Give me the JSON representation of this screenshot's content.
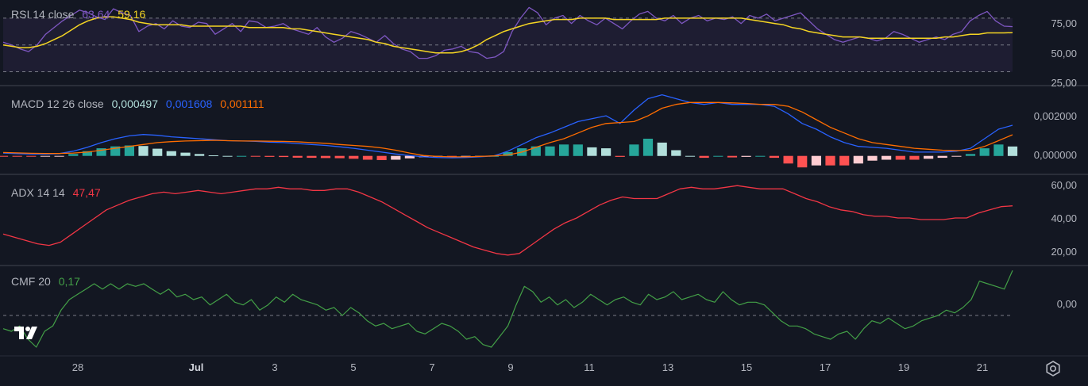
{
  "colors": {
    "background": "#131722",
    "rsi": "#7e57c2",
    "rsi_ma": "#f5d523",
    "macd": "#2962ff",
    "signal": "#ff6d00",
    "hist_pos": "#26a69a",
    "hist_neg": "#ef5350",
    "adx": "#f23645",
    "cmf": "#43a047"
  },
  "panes": {
    "rsi": {
      "name": "RSI 14 close",
      "value1": "63,64",
      "value2": "59,16",
      "ticks": [
        "75,00",
        "50,00",
        "25,00"
      ],
      "bands": [
        70,
        50,
        30
      ]
    },
    "macd": {
      "name": "MACD 12 26 close",
      "value1": "0,000497",
      "value2": "0,001608",
      "value3": "0,001111",
      "ticks": [
        "0,002000",
        "0,000000"
      ]
    },
    "adx": {
      "name": "ADX 14 14",
      "value1": "47,47",
      "ticks": [
        "60,00",
        "40,00",
        "20,00"
      ]
    },
    "cmf": {
      "name": "CMF 20",
      "value1": "0,17",
      "ticks": [
        "0,00"
      ]
    }
  },
  "x_axis": {
    "labels": [
      "28",
      "Jul",
      "3",
      "5",
      "7",
      "9",
      "11",
      "13",
      "15",
      "17",
      "19",
      "21"
    ]
  },
  "icons": {
    "logo": "tradingview-logo-icon",
    "settings": "settings-gear-icon"
  },
  "chart_data": [
    {
      "type": "line",
      "name": "RSI",
      "series": [
        {
          "name": "RSI 14 close",
          "values": [
            52,
            50,
            47,
            45,
            50,
            58,
            63,
            68,
            72,
            76,
            74,
            71,
            69,
            77,
            74,
            72,
            60,
            64,
            66,
            62,
            68,
            64,
            63,
            67,
            66,
            58,
            62,
            66,
            60,
            68,
            67,
            63,
            64,
            66,
            62,
            60,
            58,
            63,
            56,
            52,
            55,
            60,
            58,
            55,
            52,
            57,
            51,
            47,
            45,
            40,
            40,
            42,
            46,
            47,
            49,
            45,
            44,
            40,
            41,
            45,
            60,
            70,
            78,
            74,
            65,
            70,
            72,
            66,
            72,
            68,
            65,
            70,
            66,
            62,
            68,
            73,
            75,
            70,
            68,
            72,
            66,
            70,
            72,
            68,
            70,
            69,
            71,
            66,
            72,
            70,
            73,
            68,
            70,
            72,
            74,
            68,
            62,
            58,
            54,
            52,
            54,
            56,
            55,
            53,
            55,
            60,
            58,
            55,
            52,
            54,
            56,
            54,
            58,
            60,
            68,
            72,
            75,
            68,
            64,
            63.64
          ]
        },
        {
          "name": "MA",
          "values": [
            50,
            49,
            48,
            48,
            49,
            51,
            54,
            57,
            61,
            65,
            68,
            70,
            71,
            71,
            70,
            69,
            67,
            66,
            65,
            65,
            65,
            65,
            64,
            64,
            64,
            64,
            64,
            64,
            64,
            63,
            63,
            63,
            63,
            63,
            62,
            62,
            61,
            60,
            59,
            58,
            57,
            56,
            55,
            54,
            52,
            51,
            49,
            48,
            47,
            46,
            45,
            44,
            44,
            44,
            45,
            47,
            50,
            54,
            57,
            60,
            62,
            64,
            66,
            67,
            68,
            69,
            69,
            69,
            70,
            70,
            70,
            70,
            69,
            69,
            69,
            69,
            69,
            69,
            70,
            70,
            70,
            70,
            70,
            70,
            70,
            70,
            70,
            70,
            69,
            68,
            67,
            66,
            65,
            63,
            62,
            60,
            59,
            58,
            57,
            56,
            56,
            56,
            55,
            55,
            55,
            55,
            55,
            55,
            55,
            55,
            55,
            56,
            56,
            57,
            58,
            58,
            59,
            59,
            59,
            59.16
          ]
        }
      ],
      "ylim": [
        22,
        80
      ]
    },
    {
      "type": "line",
      "name": "MACD",
      "series": [
        {
          "name": "MACD",
          "values": [
            0.00015,
            0.00012,
            0.0001,
            0.0001,
            0.00012,
            0.00025,
            0.00045,
            0.0007,
            0.0009,
            0.00105,
            0.00112,
            0.00108,
            0.001,
            0.00095,
            0.0009,
            0.00085,
            0.0008,
            0.00078,
            0.00076,
            0.00072,
            0.0007,
            0.00065,
            0.0006,
            0.00055,
            0.00048,
            0.0004,
            0.0003,
            0.0002,
            0.0001,
            2e-05,
            -5e-05,
            -8e-05,
            -0.0001,
            -8e-05,
            -5e-05,
            0.0,
            0.00025,
            0.0006,
            0.00095,
            0.0012,
            0.0015,
            0.0018,
            0.00195,
            0.0021,
            0.0017,
            0.0024,
            0.003,
            0.0032,
            0.003,
            0.0028,
            0.0027,
            0.0028,
            0.0027,
            0.0027,
            0.0027,
            0.0026,
            0.0022,
            0.0017,
            0.0014,
            0.001,
            0.0007,
            0.0005,
            0.00045,
            0.0004,
            0.0003,
            0.0002,
            0.0002,
            0.0002,
            0.00025,
            0.0004,
            0.0009,
            0.0014,
            0.001608
          ]
        },
        {
          "name": "Signal",
          "values": [
            0.00018,
            0.00016,
            0.00014,
            0.00013,
            0.00013,
            0.00015,
            0.0002,
            0.0003,
            0.0004,
            0.0005,
            0.0006,
            0.0007,
            0.00075,
            0.00078,
            0.0008,
            0.00082,
            0.0008,
            0.00078,
            0.00078,
            0.00077,
            0.00076,
            0.00074,
            0.0007,
            0.00066,
            0.0006,
            0.00055,
            0.0005,
            0.00042,
            0.0003,
            0.00015,
            2e-05,
            -3e-05,
            -5e-05,
            -5e-05,
            -3e-05,
            0.0,
            5e-05,
            0.0002,
            0.00045,
            0.0007,
            0.0009,
            0.0012,
            0.0015,
            0.0017,
            0.00175,
            0.0018,
            0.0021,
            0.0025,
            0.0027,
            0.0028,
            0.0028,
            0.0028,
            0.00278,
            0.00275,
            0.0027,
            0.0027,
            0.0026,
            0.0023,
            0.0019,
            0.0015,
            0.0012,
            0.0009,
            0.0007,
            0.0006,
            0.0005,
            0.0004,
            0.00035,
            0.0003,
            0.00028,
            0.0003,
            0.0005,
            0.0008,
            0.001111
          ]
        },
        {
          "name": "Histogram",
          "values": [
            -3e-05,
            -4e-05,
            -4e-05,
            -3e-05,
            -1e-05,
            0.0001,
            0.00025,
            0.0004,
            0.0005,
            0.00055,
            0.00052,
            0.00038,
            0.00025,
            0.00017,
            0.0001,
            3e-05,
            0.0,
            0.0,
            -2e-05,
            -5e-05,
            -6e-05,
            -9e-05,
            -0.0001,
            -0.00011,
            -0.00012,
            -0.00015,
            -0.0002,
            -0.00022,
            -0.0002,
            -0.00013,
            -7e-05,
            -5e-05,
            -5e-05,
            -3e-05,
            -2e-05,
            0.0,
            0.0002,
            0.0004,
            0.0005,
            0.0005,
            0.0006,
            0.0006,
            0.00045,
            0.0004,
            -5e-05,
            0.0006,
            0.0009,
            0.0007,
            0.0003,
            0.0,
            -0.0001,
            0.0,
            -8e-05,
            -5e-05,
            0.0,
            -0.0001,
            -0.0004,
            -0.0006,
            -0.0005,
            -0.0005,
            -0.0005,
            -0.0004,
            -0.00025,
            -0.0002,
            -0.0002,
            -0.0002,
            -0.00015,
            -0.0001,
            -3e-05,
            0.0001,
            0.0004,
            0.0006,
            0.000497
          ]
        }
      ],
      "ylim": [
        -0.0008,
        0.0036
      ]
    },
    {
      "type": "line",
      "name": "ADX",
      "series": [
        {
          "name": "ADX 14 14",
          "values": [
            30,
            28,
            26,
            24,
            23,
            25,
            30,
            35,
            40,
            45,
            48,
            51,
            53,
            55,
            56,
            55,
            56,
            57,
            56,
            55,
            56,
            57,
            58,
            58,
            59,
            58,
            58,
            57,
            57,
            58,
            58,
            56,
            53,
            50,
            46,
            42,
            38,
            34,
            31,
            28,
            25,
            22,
            20,
            18,
            17,
            18,
            23,
            28,
            33,
            37,
            40,
            44,
            48,
            51,
            53,
            52,
            52,
            52,
            55,
            58,
            59,
            58,
            58,
            59,
            60,
            59,
            58,
            58,
            58,
            55,
            52,
            50,
            47,
            45,
            44,
            42,
            41,
            41,
            40,
            40,
            39,
            39,
            39,
            40,
            40,
            43,
            45,
            47,
            47.47
          ]
        }
      ],
      "ylim": [
        12,
        66
      ]
    },
    {
      "type": "line",
      "name": "CMF",
      "series": [
        {
          "name": "CMF 20",
          "values": [
            -0.05,
            -0.06,
            -0.04,
            -0.09,
            -0.12,
            -0.06,
            -0.04,
            0.02,
            0.06,
            0.08,
            0.1,
            0.12,
            0.1,
            0.12,
            0.1,
            0.12,
            0.11,
            0.12,
            0.1,
            0.08,
            0.1,
            0.07,
            0.08,
            0.06,
            0.07,
            0.04,
            0.06,
            0.08,
            0.05,
            0.04,
            0.06,
            0.02,
            0.04,
            0.07,
            0.05,
            0.08,
            0.06,
            0.05,
            0.04,
            0.02,
            0.03,
            0.0,
            0.03,
            0.01,
            -0.02,
            -0.04,
            -0.03,
            -0.05,
            -0.04,
            -0.03,
            -0.06,
            -0.07,
            -0.05,
            -0.03,
            -0.04,
            -0.06,
            -0.09,
            -0.08,
            -0.11,
            -0.12,
            -0.08,
            -0.04,
            0.04,
            0.11,
            0.09,
            0.05,
            0.07,
            0.04,
            0.06,
            0.03,
            0.05,
            0.08,
            0.06,
            0.04,
            0.06,
            0.07,
            0.05,
            0.04,
            0.08,
            0.06,
            0.07,
            0.09,
            0.06,
            0.07,
            0.08,
            0.06,
            0.05,
            0.09,
            0.06,
            0.04,
            0.05,
            0.05,
            0.04,
            0.01,
            -0.02,
            -0.04,
            -0.04,
            -0.05,
            -0.07,
            -0.08,
            -0.09,
            -0.07,
            -0.06,
            -0.09,
            -0.05,
            -0.02,
            -0.03,
            -0.01,
            -0.03,
            -0.05,
            -0.04,
            -0.02,
            -0.01,
            0.0,
            0.02,
            0.01,
            0.03,
            0.06,
            0.13,
            0.12,
            0.11,
            0.1,
            0.17
          ]
        }
      ],
      "ylim": [
        -0.15,
        0.18
      ]
    }
  ]
}
